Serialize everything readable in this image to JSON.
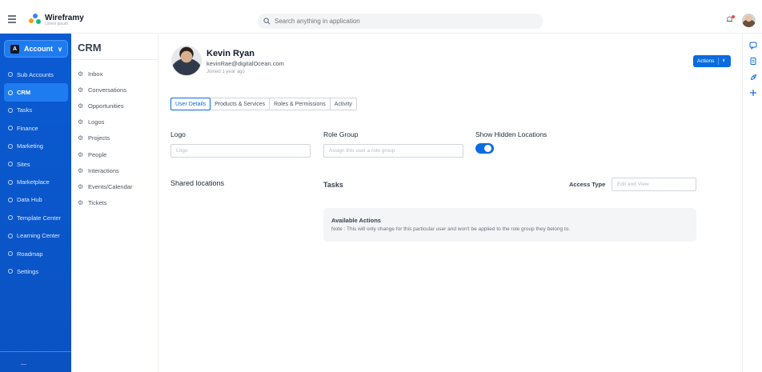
{
  "app": {
    "brand_name": "Wireframy",
    "brand_tagline": "Lorem ipsum",
    "search_placeholder": "Search anything in application"
  },
  "sidebar": {
    "account_badge": "A",
    "account_label": "Account",
    "items": [
      {
        "label": "Sub Accounts",
        "active": false
      },
      {
        "label": "CRM",
        "active": true
      },
      {
        "label": "Tasks",
        "active": false
      },
      {
        "label": "Finance",
        "active": false
      },
      {
        "label": "Marketing",
        "active": false
      },
      {
        "label": "Sites",
        "active": false
      },
      {
        "label": "Marketplace",
        "active": false
      },
      {
        "label": "Data Hub",
        "active": false
      },
      {
        "label": "Template Center",
        "active": false
      },
      {
        "label": "Learning Center",
        "active": false
      },
      {
        "label": "Roadmap",
        "active": false
      },
      {
        "label": "Settings",
        "active": false
      }
    ]
  },
  "crm": {
    "title": "CRM",
    "items": [
      "Inbox",
      "Conversations",
      "Opportunities",
      "Logos",
      "Projects",
      "People",
      "Interactions",
      "Events/Calendar",
      "Tickets"
    ]
  },
  "profile": {
    "name": "Kevin Ryan",
    "email": "kevinRae@digitalOcean.com",
    "joined": "Joined 1 year ago",
    "actions_label": "Actions"
  },
  "tabs": [
    "User Details",
    "Products & Services",
    "Roles & Permissions",
    "Activity"
  ],
  "form": {
    "logo_label": "Logo",
    "logo_placeholder": "Logo",
    "role_group_label": "Role Group",
    "role_group_placeholder": "Assign this user a role group",
    "hidden_locations_label": "Show Hidden Locations",
    "hidden_locations_on": true,
    "shared_locations_label": "Shared locations",
    "tasks_label": "Tasks",
    "access_type_label": "Access Type",
    "access_type_placeholder": "Edit and View",
    "available_actions_title": "Available Actions",
    "available_actions_note": "Note : This will only change for this particular user and won't be applied to the role group they belong to."
  },
  "colors": {
    "primary": "#0b6be0",
    "sidebar": "#0b5bd3",
    "sidebar_active": "#1f7cf0"
  }
}
